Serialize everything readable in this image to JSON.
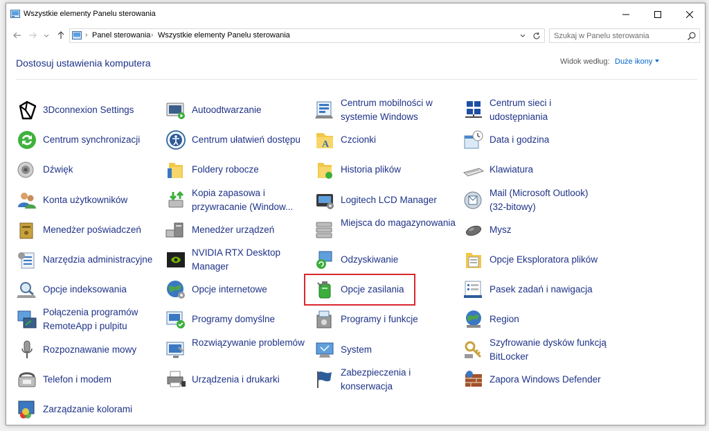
{
  "window": {
    "title": "Wszystkie elementy Panelu sterowania"
  },
  "address": {
    "crumbs": [
      "Panel sterowania",
      "Wszystkie elementy Panelu sterowania"
    ]
  },
  "search": {
    "placeholder": "Szukaj w Panelu sterowania"
  },
  "header": {
    "title": "Dostosuj ustawienia komputera",
    "view_by_label": "Widok według:",
    "view_by_value": "Duże ikony"
  },
  "colors": {
    "link": "#1e3287",
    "accent": "#0066cc",
    "highlight": "#d9262e"
  },
  "items": [
    {
      "label": "3Dconnexion Settings",
      "icon": "3dconnexion-icon"
    },
    {
      "label": "Autoodtwarzanie",
      "icon": "autoplay-icon"
    },
    {
      "label": "Centrum mobilności w systemie Windows",
      "icon": "mobility-center-icon"
    },
    {
      "label": "Centrum sieci i udostępniania",
      "icon": "network-center-icon"
    },
    {
      "label": "Centrum synchronizacji",
      "icon": "sync-center-icon"
    },
    {
      "label": "Centrum ułatwień dostępu",
      "icon": "ease-of-access-icon"
    },
    {
      "label": "Czcionki",
      "icon": "fonts-icon"
    },
    {
      "label": "Data i godzina",
      "icon": "date-time-icon"
    },
    {
      "label": "Dźwięk",
      "icon": "sound-icon"
    },
    {
      "label": "Foldery robocze",
      "icon": "work-folders-icon"
    },
    {
      "label": "Historia plików",
      "icon": "file-history-icon"
    },
    {
      "label": "Klawiatura",
      "icon": "keyboard-icon"
    },
    {
      "label": "Konta użytkowników",
      "icon": "user-accounts-icon"
    },
    {
      "label": "Kopia zapasowa i przywracanie (Window...",
      "icon": "backup-restore-icon"
    },
    {
      "label": "Logitech LCD Manager",
      "icon": "logitech-lcd-icon"
    },
    {
      "label": "Mail (Microsoft Outlook) (32-bitowy)",
      "icon": "mail-icon"
    },
    {
      "label": "Menedżer poświadczeń",
      "icon": "credential-manager-icon"
    },
    {
      "label": "Menedżer urządzeń",
      "icon": "device-manager-icon"
    },
    {
      "label": "Miejsca do magazynowania",
      "icon": "storage-spaces-icon"
    },
    {
      "label": "Mysz",
      "icon": "mouse-icon"
    },
    {
      "label": "Narzędzia administracyjne",
      "icon": "admin-tools-icon"
    },
    {
      "label": "NVIDIA RTX Desktop Manager",
      "icon": "nvidia-icon"
    },
    {
      "label": "Odzyskiwanie",
      "icon": "recovery-icon"
    },
    {
      "label": "Opcje Eksploratora plików",
      "icon": "explorer-options-icon"
    },
    {
      "label": "Opcje indeksowania",
      "icon": "indexing-icon"
    },
    {
      "label": "Opcje internetowe",
      "icon": "internet-options-icon"
    },
    {
      "label": "Opcje zasilania",
      "icon": "power-options-icon"
    },
    {
      "label": "Pasek zadań i nawigacja",
      "icon": "taskbar-icon"
    },
    {
      "label": "Połączenia programów RemoteApp i pulpitu",
      "icon": "remoteapp-icon"
    },
    {
      "label": "Programy domyślne",
      "icon": "default-programs-icon"
    },
    {
      "label": "Programy i funkcje",
      "icon": "programs-features-icon"
    },
    {
      "label": "Region",
      "icon": "region-icon"
    },
    {
      "label": "Rozpoznawanie mowy",
      "icon": "speech-icon"
    },
    {
      "label": "Rozwiązywanie problemów",
      "icon": "troubleshoot-icon"
    },
    {
      "label": "System",
      "icon": "system-icon"
    },
    {
      "label": "Szyfrowanie dysków funkcją BitLocker",
      "icon": "bitlocker-icon"
    },
    {
      "label": "Telefon i modem",
      "icon": "phone-modem-icon"
    },
    {
      "label": "Urządzenia i drukarki",
      "icon": "devices-printers-icon"
    },
    {
      "label": "Zabezpieczenia i konserwacja",
      "icon": "security-maintenance-icon"
    },
    {
      "label": "Zapora Windows Defender",
      "icon": "firewall-icon"
    },
    {
      "label": "Zarządzanie kolorami",
      "icon": "color-management-icon"
    }
  ]
}
